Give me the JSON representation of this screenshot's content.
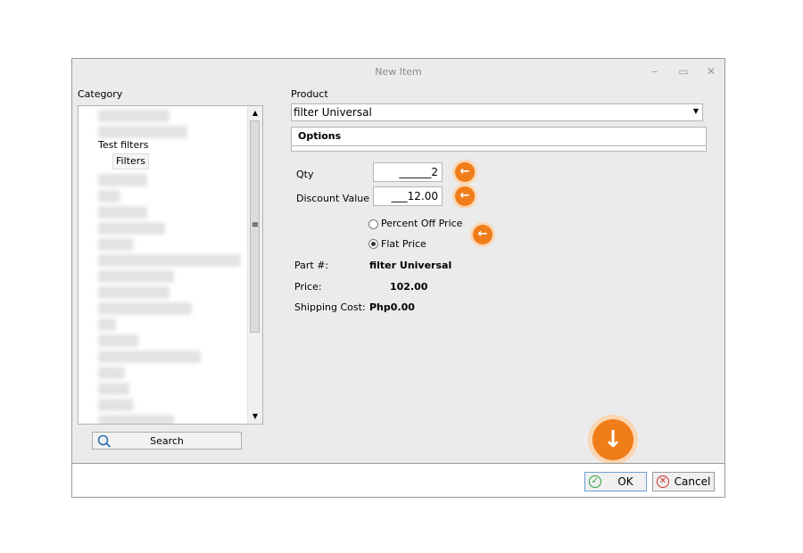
{
  "window": {
    "title": "New Item",
    "min_icon": "minimize-icon",
    "max_icon": "maximize-icon",
    "close_icon": "close-icon"
  },
  "category": {
    "label": "Category",
    "items": [
      {
        "label": "Test filters",
        "level": 1
      },
      {
        "label": "Filters",
        "level": 2
      }
    ],
    "search_label": "Search"
  },
  "product": {
    "label": "Product",
    "selected": "filter Universal",
    "options_header": "Options"
  },
  "form": {
    "qty_label": "Qty",
    "qty_value": "______2",
    "discount_label": "Discount Value",
    "discount_value": "___12.00",
    "radio_percent": "Percent Off Price",
    "radio_flat": "Flat Price",
    "selected_radio": "Flat Price"
  },
  "details": {
    "part_label": "Part #:",
    "part_value": "filter Universal",
    "price_label": "Price:",
    "price_value": "102.00",
    "shipping_label": "Shipping Cost:",
    "shipping_value": "Php0.00"
  },
  "buttons": {
    "ok": "OK",
    "cancel": "Cancel"
  },
  "colors": {
    "accent": "#f07d1a",
    "ok_icon": "#2e9e3f",
    "cancel_icon": "#d0312d"
  }
}
